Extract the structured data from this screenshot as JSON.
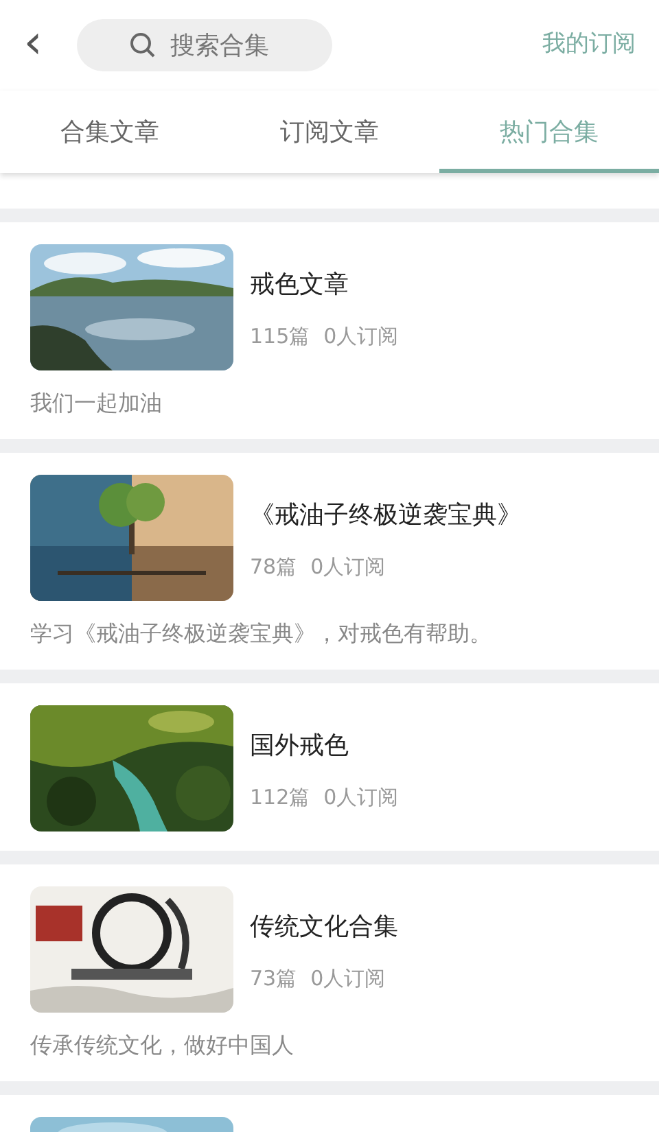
{
  "header": {
    "back": "‹",
    "search": {
      "placeholder": "搜索合集"
    },
    "my_subscriptions": "我的订阅"
  },
  "tabs": [
    {
      "label": "合集文章",
      "selected": false
    },
    {
      "label": "订阅文章",
      "selected": false
    },
    {
      "label": "热门合集",
      "selected": true
    }
  ],
  "collections": [
    {
      "title": "戒色文章",
      "count": "115篇",
      "subscribers": "0人订阅",
      "description": "我们一起加油",
      "kind": "picture"
    },
    {
      "title": "《戒油子终极逆袭宝典》",
      "count": "78篇",
      "subscribers": "0人订阅",
      "description": "学习《戒油子终极逆袭宝典》，对戒色有帮助。",
      "kind": "picture"
    },
    {
      "title": "国外戒色",
      "count": "112篇",
      "subscribers": "0人订阅",
      "kind": "picture"
    },
    {
      "title": "传统文化合集",
      "count": "73篇",
      "subscribers": "0人订阅",
      "description": "传承传统文化，做好中国人",
      "kind": "picture"
    },
    {
      "kind": "picture"
    }
  ]
}
